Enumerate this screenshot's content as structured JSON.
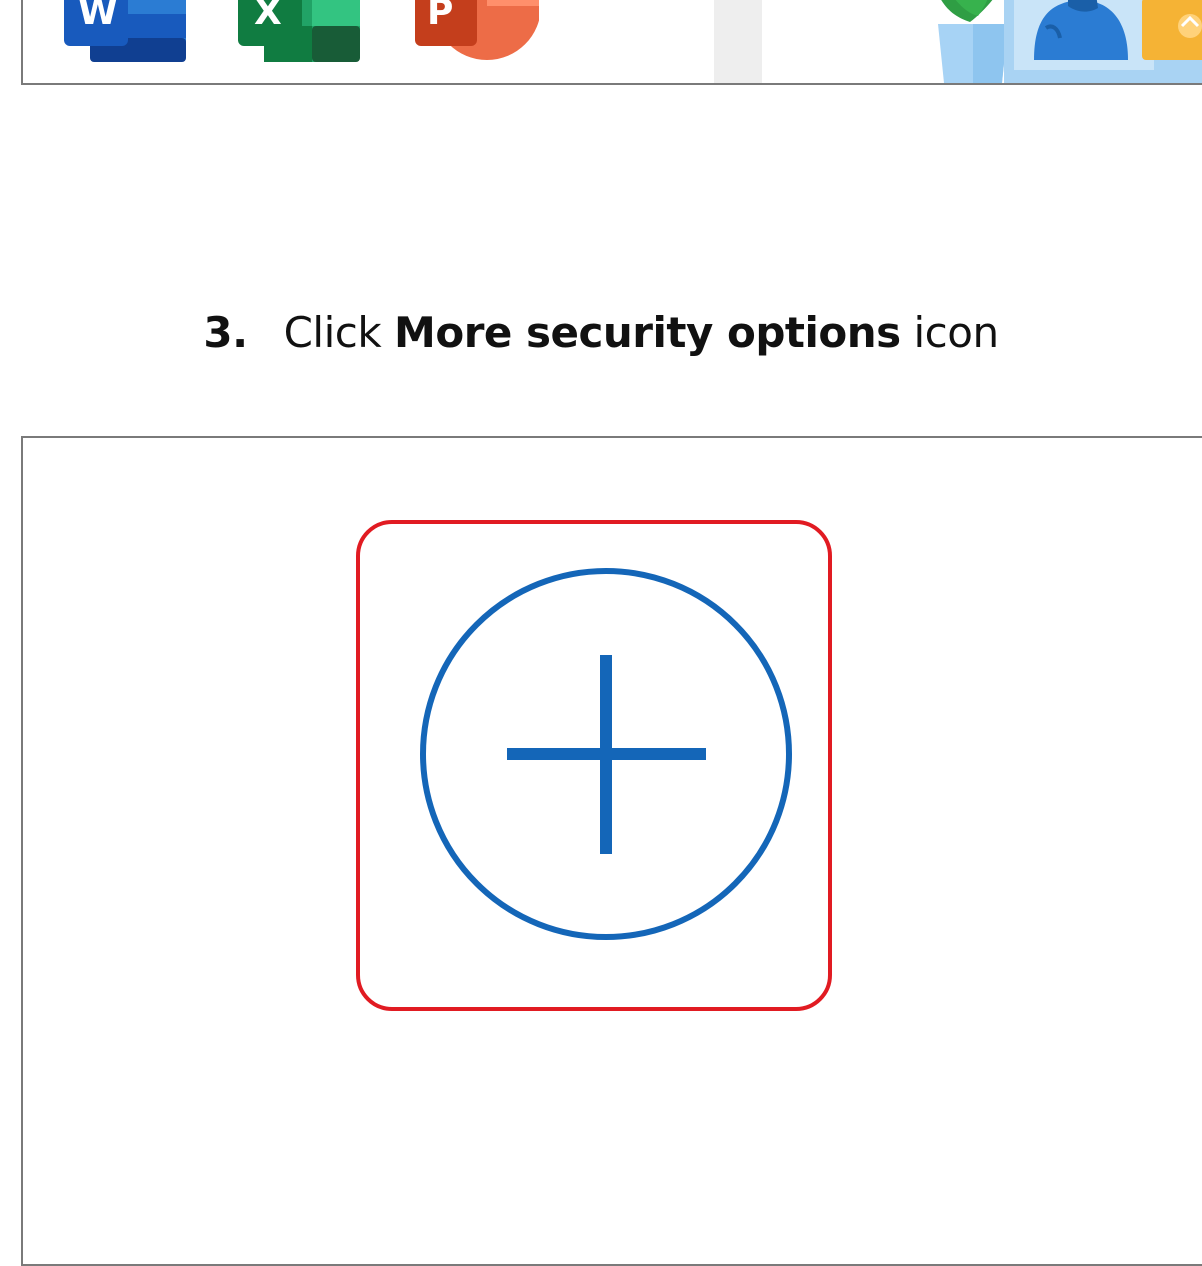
{
  "top_panel": {
    "apps": [
      {
        "name": "Word",
        "letter": "W"
      },
      {
        "name": "Excel",
        "letter": "X"
      },
      {
        "name": "PowerPoint",
        "letter": "P"
      }
    ]
  },
  "step": {
    "number": "3.",
    "prefix": "Click ",
    "target": "More security options",
    "suffix": " icon"
  },
  "colors": {
    "highlight": "#e11b22",
    "icon_blue": "#1466b8",
    "panel_border": "#7a7a7a"
  },
  "icons": {
    "main": "add-circle-icon"
  }
}
